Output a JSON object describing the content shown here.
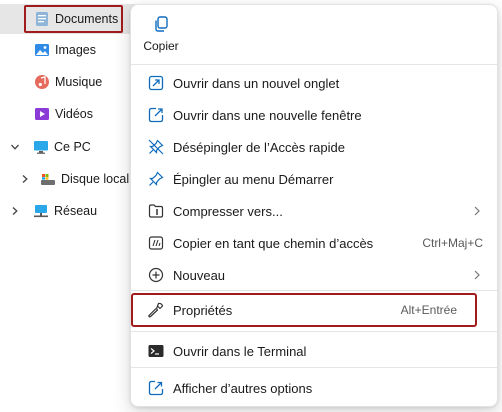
{
  "sidebar": {
    "items": [
      {
        "label": "Documents",
        "icon": "documents-icon"
      },
      {
        "label": "Images",
        "icon": "images-icon"
      },
      {
        "label": "Musique",
        "icon": "music-icon"
      },
      {
        "label": "Vidéos",
        "icon": "videos-icon"
      },
      {
        "label": "Ce PC",
        "icon": "computer-icon"
      },
      {
        "label": "Disque local",
        "icon": "local-disk-icon"
      },
      {
        "label": "Réseau",
        "icon": "network-icon"
      }
    ]
  },
  "context_menu": {
    "quick_actions": [
      {
        "label": "Copier",
        "icon": "copy-icon"
      }
    ],
    "items": [
      {
        "label": "Ouvrir dans un nouvel onglet",
        "icon": "new-tab-icon",
        "shortcut": ""
      },
      {
        "label": "Ouvrir dans une nouvelle fenêtre",
        "icon": "new-window-icon",
        "shortcut": ""
      },
      {
        "label": "Désépingler de l’Accès rapide",
        "icon": "unpin-icon",
        "shortcut": ""
      },
      {
        "label": "Épingler au menu Démarrer",
        "icon": "pin-icon",
        "shortcut": ""
      },
      {
        "label": "Compresser vers...",
        "icon": "compress-icon",
        "shortcut": "",
        "submenu": true
      },
      {
        "label": "Copier en tant que chemin d’accès",
        "icon": "copy-path-icon",
        "shortcut": "Ctrl+Maj+C"
      },
      {
        "label": "Nouveau",
        "icon": "new-icon",
        "shortcut": "",
        "submenu": true
      },
      {
        "label": "Propriétés",
        "icon": "wrench-icon",
        "shortcut": "Alt+Entrée"
      },
      {
        "label": "Ouvrir dans le Terminal",
        "icon": "terminal-icon",
        "shortcut": ""
      },
      {
        "label": "Afficher d’autres options",
        "icon": "more-options-icon",
        "shortcut": ""
      }
    ]
  },
  "colors": {
    "highlight_border": "#a01b1b",
    "selected_bg": "#e6e6e6",
    "accent_blue": "#0f6cbd"
  }
}
